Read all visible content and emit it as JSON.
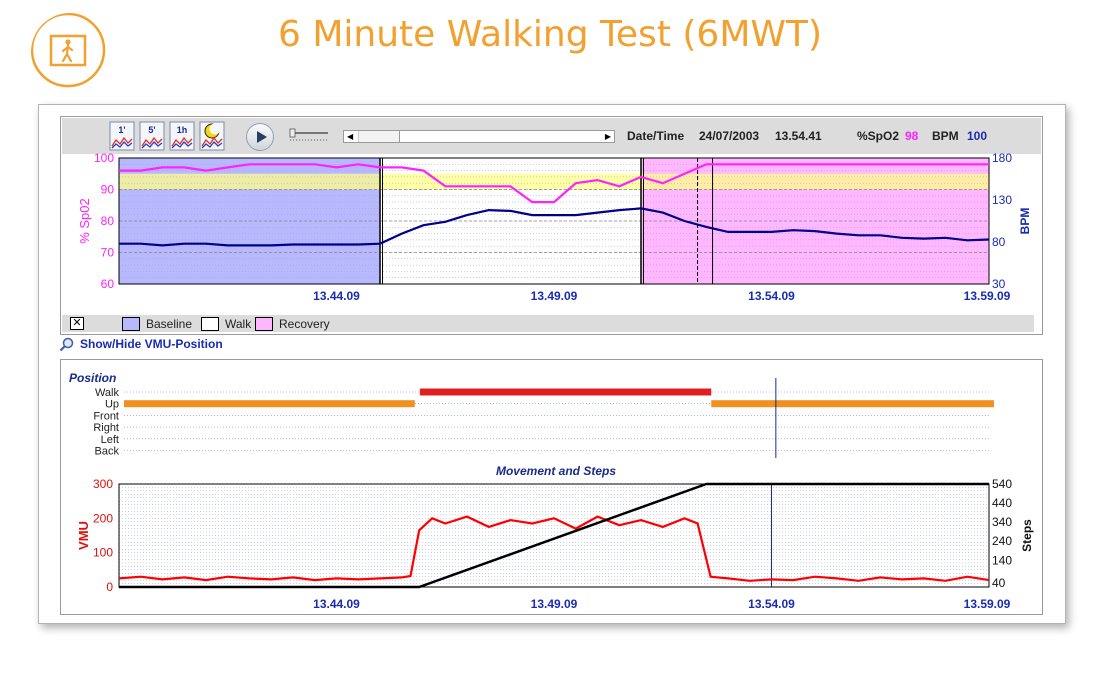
{
  "title": "6 Minute Walking Test (6MWT)",
  "toolbar": {
    "buttons": [
      "1'",
      "5'",
      "1h"
    ],
    "date_label": "Date/Time",
    "date": "24/07/2003",
    "time": "13.54.41",
    "spo2_label": "%SpO2",
    "spo2_value": "98",
    "bpm_label": "BPM",
    "bpm_value": "100"
  },
  "legend": {
    "items": [
      {
        "label": "Baseline",
        "color": "#b8b8ff"
      },
      {
        "label": "Walk",
        "color": "#ffffff"
      },
      {
        "label": "Recovery",
        "color": "#ffb8ff"
      }
    ]
  },
  "show_hide_label": "Show/Hide VMU-Position",
  "colors": {
    "spo2": "#ff22ff",
    "bpm": "#00008b",
    "vmu": "#ff0000",
    "steps": "#000000",
    "walk_bar": "#e02020",
    "up_bar": "#f09020",
    "accent": "#f2a02e"
  },
  "chart_data": [
    {
      "type": "line",
      "title": "",
      "x_ticks": [
        "13.44.09",
        "13.49.09",
        "13.54.09",
        "13.59.09"
      ],
      "x_range_minutes": [
        0,
        20
      ],
      "x_tick_positions_minutes": [
        5,
        10,
        15,
        20
      ],
      "left_axis": {
        "label": "% Sp02",
        "ticks": [
          100,
          90,
          80,
          70,
          60
        ],
        "range": [
          60,
          100
        ]
      },
      "right_axis": {
        "label": "BPM",
        "ticks": [
          180,
          130,
          80,
          30
        ],
        "range": [
          30,
          180
        ]
      },
      "phases": [
        {
          "name": "Baseline",
          "start": 0,
          "end": 6.0
        },
        {
          "name": "Walk",
          "start": 6.0,
          "end": 12.0
        },
        {
          "name": "Recovery",
          "start": 12.0,
          "end": 20.0
        }
      ],
      "bands": [
        {
          "range": [
            90,
            95
          ],
          "axis": "left",
          "color": "#ffff88"
        }
      ],
      "cursor_minute": 13.3,
      "series": [
        {
          "name": "%SpO2",
          "axis": "left",
          "x": [
            0,
            0.5,
            1,
            1.5,
            2,
            2.5,
            3,
            3.5,
            4,
            4.5,
            5,
            5.5,
            6,
            6.5,
            7,
            7.5,
            8,
            8.5,
            9,
            9.5,
            10,
            10.5,
            11,
            11.5,
            12,
            12.5,
            13,
            13.5,
            14,
            14.5,
            15,
            15.5,
            16,
            16.5,
            17,
            17.5,
            18,
            18.5,
            19,
            19.5,
            20
          ],
          "values": [
            96,
            96,
            97,
            97,
            96,
            97,
            98,
            98,
            98,
            98,
            97,
            98,
            97,
            97,
            96,
            91,
            91,
            91,
            91,
            86,
            86,
            92,
            93,
            91,
            94,
            92,
            95,
            98,
            98,
            98,
            98,
            98,
            98,
            98,
            98,
            98,
            98,
            98,
            98,
            98,
            98
          ]
        },
        {
          "name": "BPM",
          "axis": "right",
          "x": [
            0,
            0.5,
            1,
            1.5,
            2,
            2.5,
            3,
            3.5,
            4,
            4.5,
            5,
            5.5,
            6,
            6.5,
            7,
            7.5,
            8,
            8.5,
            9,
            9.5,
            10,
            10.5,
            11,
            11.5,
            12,
            12.5,
            13,
            13.5,
            14,
            14.5,
            15,
            15.5,
            16,
            16.5,
            17,
            17.5,
            18,
            18.5,
            19,
            19.5,
            20
          ],
          "values": [
            78,
            78,
            76,
            78,
            78,
            76,
            76,
            76,
            77,
            77,
            77,
            77,
            78,
            90,
            100,
            104,
            112,
            118,
            117,
            112,
            112,
            112,
            115,
            118,
            120,
            115,
            105,
            98,
            92,
            92,
            92,
            94,
            93,
            90,
            88,
            88,
            85,
            84,
            85,
            82,
            83
          ]
        }
      ]
    },
    {
      "type": "line",
      "title": "Position",
      "y_categories": [
        "Walk",
        "Up",
        "Front",
        "Right",
        "Left",
        "Back"
      ],
      "segments": [
        {
          "category": "Up",
          "start": 0,
          "end": 6.8
        },
        {
          "category": "Walk",
          "start": 6.8,
          "end": 13.5
        },
        {
          "category": "Up",
          "start": 13.5,
          "end": 20
        }
      ],
      "cursor_minute": 15.1
    },
    {
      "type": "line",
      "title": "Movement and Steps",
      "x_ticks": [
        "13.44.09",
        "13.49.09",
        "13.54.09",
        "13.59.09"
      ],
      "x_range_minutes": [
        0,
        20
      ],
      "x_tick_positions_minutes": [
        5,
        10,
        15,
        20
      ],
      "left_axis": {
        "label": "VMU",
        "ticks": [
          300,
          200,
          100,
          0
        ],
        "range": [
          0,
          300
        ]
      },
      "right_axis": {
        "label": "Steps",
        "ticks": [
          540,
          440,
          340,
          240,
          140,
          40
        ],
        "range": [
          0,
          540
        ]
      },
      "cursor_minute": 15.0,
      "series": [
        {
          "name": "VMU",
          "axis": "left",
          "x": [
            0,
            0.5,
            1,
            1.5,
            2,
            2.5,
            3,
            3.5,
            4,
            4.5,
            5,
            5.5,
            6,
            6.5,
            6.7,
            6.9,
            7.2,
            7.5,
            8,
            8.5,
            9,
            9.5,
            10,
            10.5,
            11,
            11.5,
            12,
            12.5,
            13,
            13.3,
            13.6,
            14,
            14.5,
            15,
            15.5,
            16,
            16.5,
            17,
            17.5,
            18,
            18.5,
            19,
            19.5,
            20
          ],
          "values": [
            25,
            30,
            22,
            28,
            20,
            30,
            25,
            22,
            28,
            20,
            25,
            22,
            25,
            28,
            32,
            165,
            200,
            185,
            205,
            175,
            195,
            185,
            200,
            170,
            205,
            180,
            195,
            175,
            200,
            185,
            30,
            25,
            18,
            22,
            20,
            30,
            25,
            18,
            28,
            22,
            25,
            18,
            30,
            20
          ]
        },
        {
          "name": "Steps",
          "axis": "right",
          "x": [
            0,
            6.9,
            13.5,
            20
          ],
          "values": [
            0,
            0,
            540,
            540
          ]
        }
      ]
    }
  ]
}
